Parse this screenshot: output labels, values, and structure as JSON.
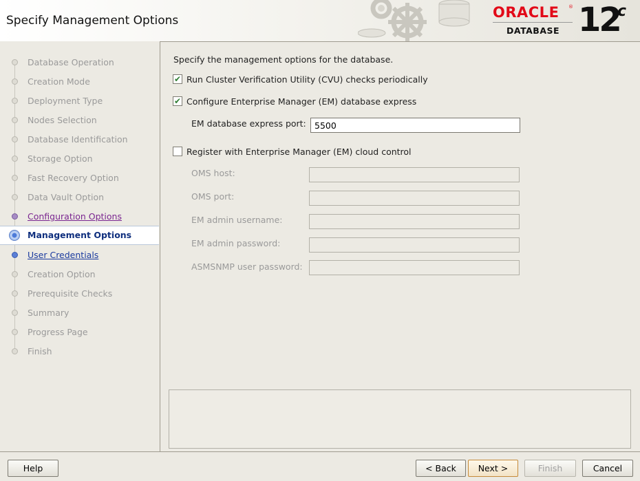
{
  "header": {
    "title": "Specify Management Options",
    "logo_brand": "ORACLE",
    "logo_product": "DATABASE",
    "logo_version": "12",
    "logo_version_suffix": "c"
  },
  "nav": {
    "items": [
      {
        "label": "Database Operation",
        "state": "disabled"
      },
      {
        "label": "Creation Mode",
        "state": "disabled"
      },
      {
        "label": "Deployment Type",
        "state": "disabled"
      },
      {
        "label": "Nodes Selection",
        "state": "disabled"
      },
      {
        "label": "Database Identification",
        "state": "disabled"
      },
      {
        "label": "Storage Option",
        "state": "disabled"
      },
      {
        "label": "Fast Recovery Option",
        "state": "disabled"
      },
      {
        "label": "Data Vault Option",
        "state": "disabled"
      },
      {
        "label": "Configuration Options",
        "state": "visited"
      },
      {
        "label": "Management Options",
        "state": "current"
      },
      {
        "label": "User Credentials",
        "state": "link"
      },
      {
        "label": "Creation Option",
        "state": "disabled"
      },
      {
        "label": "Prerequisite Checks",
        "state": "disabled"
      },
      {
        "label": "Summary",
        "state": "disabled"
      },
      {
        "label": "Progress Page",
        "state": "disabled"
      },
      {
        "label": "Finish",
        "state": "disabled"
      }
    ]
  },
  "main": {
    "intro": "Specify the management options for the database.",
    "cvu_checkbox": {
      "label": "Run Cluster Verification Utility (CVU) checks periodically",
      "checked": true
    },
    "em_express_checkbox": {
      "label": "Configure Enterprise Manager (EM) database express",
      "checked": true
    },
    "em_port": {
      "label": "EM database express port:",
      "value": "5500"
    },
    "cloud_control_checkbox": {
      "label": "Register with Enterprise Manager (EM) cloud control",
      "checked": false
    },
    "oms_host": {
      "label": "OMS host:",
      "value": ""
    },
    "oms_port": {
      "label": "OMS port:",
      "value": ""
    },
    "em_admin_username": {
      "label": "EM admin username:",
      "value": ""
    },
    "em_admin_password": {
      "label": "EM admin password:",
      "value": ""
    },
    "asmsnmp_password": {
      "label": "ASMSNMP user password:",
      "value": ""
    }
  },
  "footer": {
    "help": "Help",
    "back": "< Back",
    "next": "Next >",
    "finish": "Finish",
    "cancel": "Cancel"
  },
  "colors": {
    "oracle_red": "#E20A18",
    "current_step_blue": "#0F2F7E",
    "visited_purple": "#7A2590",
    "link_blue": "#1A3A9E",
    "checkmark_green": "#2E7D32"
  }
}
